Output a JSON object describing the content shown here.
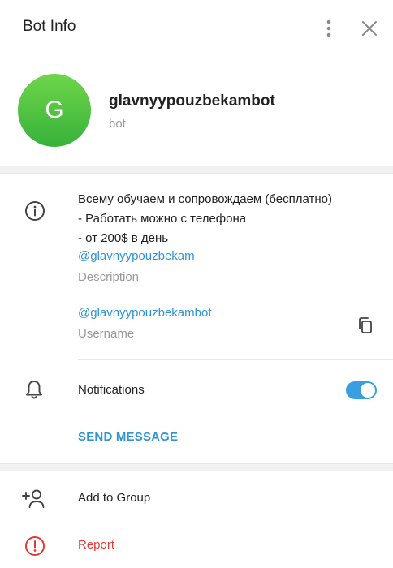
{
  "header": {
    "title": "Bot Info",
    "more_icon": "vertical-dots-icon",
    "close_icon": "close-icon"
  },
  "profile": {
    "avatar_letter": "G",
    "avatar_colors": [
      "#6fd54a",
      "#36b23a"
    ],
    "name": "glavnyypouzbekambot",
    "subtitle": "bot"
  },
  "info": {
    "icon": "info-icon",
    "description_lines": [
      "Всему обучаем и сопровождаем (бесплатно)",
      "- Работать можно с телефона",
      "- от 200$ в день"
    ],
    "description_link": "@glavnyypouzbekam",
    "description_caption": "Description",
    "username": "@glavnyypouzbekambot",
    "username_caption": "Username",
    "copy_icon": "copy-icon"
  },
  "notifications": {
    "icon": "bell-icon",
    "label": "Notifications",
    "enabled": true,
    "accent": "#3a9fe0"
  },
  "actions": {
    "send_message": "SEND MESSAGE",
    "add_to_group": "Add to Group",
    "add_icon": "add-user-icon",
    "report": "Report",
    "report_icon": "report-icon",
    "report_color": "#e53935",
    "link_color": "#2f94d7"
  }
}
